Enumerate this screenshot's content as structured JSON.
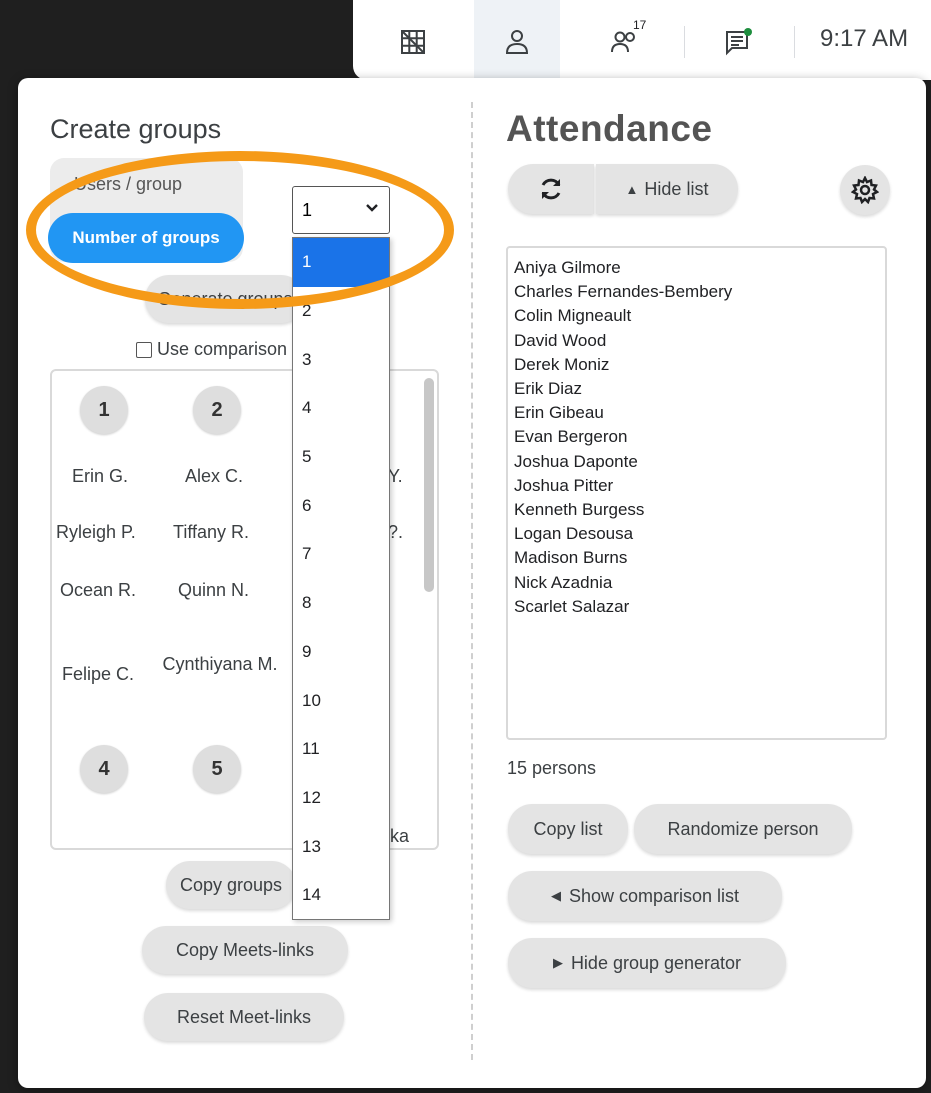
{
  "topbar": {
    "time": "9:17 AM",
    "participants_count": "17",
    "icons": [
      "grid-off-icon",
      "person-icon",
      "people-icon",
      "chat-icon"
    ]
  },
  "create_groups": {
    "title": "Create groups",
    "users_per_group_label": "Users / group",
    "number_of_groups_label": "Number of groups",
    "select_value": "1",
    "generate_label": "Generate groups",
    "use_comparison_label": "Use comparison list",
    "groups": [
      {
        "number": "1",
        "members": [
          "Erin G.",
          "Ryleigh P.",
          "Ocean R.",
          "Felipe C."
        ]
      },
      {
        "number": "2",
        "members": [
          "Alex C.",
          "Tiffany R.",
          "Quinn N.",
          "Cynthiyana M."
        ]
      },
      {
        "number": "4",
        "members": []
      },
      {
        "number": "5",
        "members": []
      }
    ],
    "partial_names": [
      "Y.",
      "?.",
      "ka"
    ],
    "copy_groups_label": "Copy groups",
    "copy_meets_label": "Copy Meets-links",
    "reset_meet_label": "Reset Meet-links",
    "dropdown_options": [
      "1",
      "2",
      "3",
      "4",
      "5",
      "6",
      "7",
      "8",
      "9",
      "10",
      "11",
      "12",
      "13",
      "14"
    ]
  },
  "attendance": {
    "title": "Attendance",
    "hide_list_label": "Hide list",
    "names": [
      "Aniya Gilmore",
      "Charles Fernandes-Bembery",
      "Colin Migneault",
      "David Wood",
      "Derek Moniz",
      "Erik Diaz",
      "Erin Gibeau",
      "Evan Bergeron",
      "Joshua Daponte",
      "Joshua Pitter",
      "Kenneth Burgess",
      "Logan Desousa",
      "Madison Burns",
      "Nick Azadnia",
      "Scarlet Salazar"
    ],
    "count_label": "15 persons",
    "copy_list_label": "Copy list",
    "randomize_label": "Randomize person",
    "show_comparison_label": "Show comparison list",
    "hide_generator_label": "Hide group generator"
  },
  "colors": {
    "accent": "#2196f3",
    "highlight": "#f59a18",
    "dropdown_selected": "#1a73e8"
  }
}
